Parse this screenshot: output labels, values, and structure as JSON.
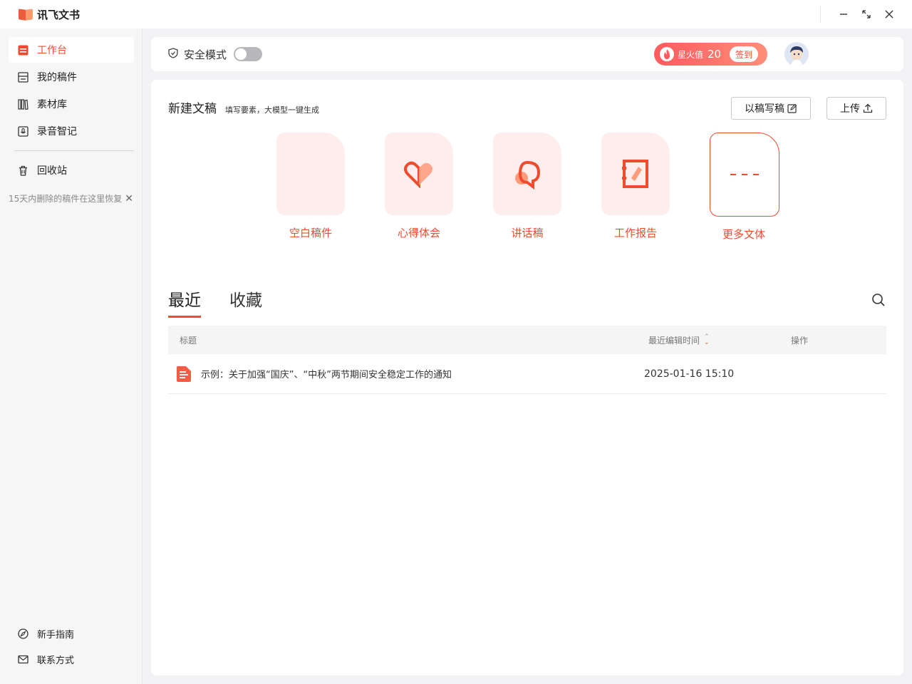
{
  "app": {
    "title": "讯飞文书"
  },
  "window": {
    "minimize": "—",
    "maximize": "⤡",
    "close": "✕"
  },
  "sidebar": {
    "items": [
      {
        "label": "工作台",
        "icon": "workbench-icon",
        "active": true
      },
      {
        "label": "我的稿件",
        "icon": "drafts-icon"
      },
      {
        "label": "素材库",
        "icon": "library-icon"
      },
      {
        "label": "录音智记",
        "icon": "recording-icon"
      },
      {
        "label": "回收站",
        "icon": "trash-icon"
      }
    ],
    "recycle_hint": "15天内删除的稿件在这里恢复",
    "bottom": [
      {
        "label": "新手指南",
        "icon": "compass-icon"
      },
      {
        "label": "联系方式",
        "icon": "mail-icon"
      }
    ]
  },
  "topbar": {
    "safe_mode_label": "安全模式",
    "safe_mode_on": false,
    "spark_label": "星火值",
    "spark_value": "20",
    "checkin_label": "签到"
  },
  "new_doc": {
    "title": "新建文稿",
    "subtitle": "填写要素，大模型一键生成",
    "rewrite_button": "以稿写稿",
    "upload_button": "上传",
    "types": [
      {
        "label": "空白稿件"
      },
      {
        "label": "心得体会"
      },
      {
        "label": "讲话稿"
      },
      {
        "label": "工作报告"
      },
      {
        "label": "更多文体"
      }
    ]
  },
  "tabs": [
    {
      "label": "最近",
      "active": true
    },
    {
      "label": "收藏"
    }
  ],
  "table": {
    "columns": [
      "标题",
      "最近编辑时间",
      "操作"
    ],
    "rows": [
      {
        "title": "示例：关于加强“国庆”、“中秋”两节期间安全稳定工作的通知",
        "time": "2025-01-16 15:10"
      }
    ]
  },
  "colors": {
    "accent": "#ef4b2f",
    "accent_soft": "#fdeeed"
  }
}
